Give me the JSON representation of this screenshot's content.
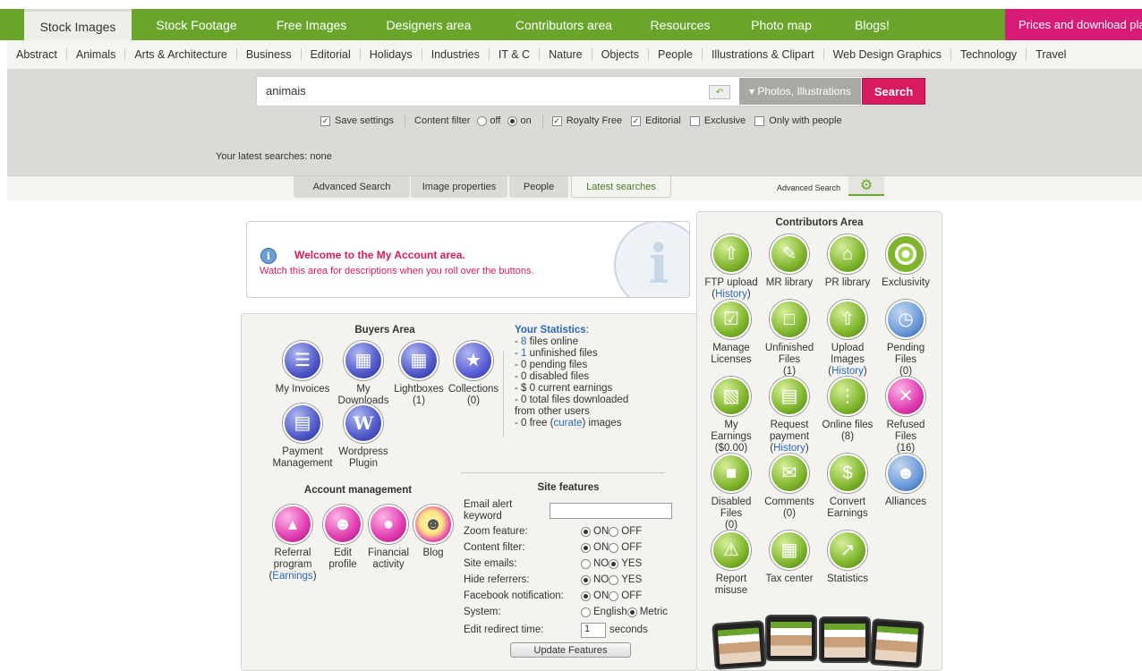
{
  "top_tabs": [
    "Stock Images",
    "Stock Footage",
    "Free Images",
    "Designers area",
    "Contributors area",
    "Resources",
    "Photo map",
    "Blogs!"
  ],
  "prices_label": "Prices and download plan",
  "categories": [
    "Abstract",
    "Animals",
    "Arts & Architecture",
    "Business",
    "Editorial",
    "Holidays",
    "Industries",
    "IT & C",
    "Nature",
    "Objects",
    "People",
    "Illustrations & Clipart",
    "Web Design Graphics",
    "Technology",
    "Travel"
  ],
  "search": {
    "value": "animais",
    "type_label": "Photos, Illustrations",
    "button": "Search"
  },
  "options": {
    "save_settings": "Save settings",
    "content_filter": "Content filter",
    "off": "off",
    "on": "on",
    "royalty_free": "Royalty Free",
    "editorial": "Editorial",
    "exclusive": "Exclusive",
    "only_people": "Only with people"
  },
  "latest_searches": "Your latest searches:  none",
  "subtabs": [
    "Advanced Search",
    "Image properties",
    "People",
    "Latest searches"
  ],
  "advanced_link": "Advanced Search",
  "welcome": {
    "title": "Welcome to the My Account area.",
    "desc": "Watch this area for descriptions when you roll over the buttons."
  },
  "buyers": {
    "title": "Buyers Area",
    "items": [
      {
        "l1": "My Invoices",
        "l2": ""
      },
      {
        "l1": "My",
        "l2": "Downloads"
      },
      {
        "l1": "Lightboxes",
        "l2": "(1)"
      },
      {
        "l1": "Collections",
        "l2": "(0)"
      },
      {
        "l1": "Payment",
        "l2": "Management"
      },
      {
        "l1": "Wordpress",
        "l2": "Plugin"
      }
    ]
  },
  "stats": {
    "title": "Your Statistics",
    "colon": ":",
    "dash": "- ",
    "n8": "8",
    "files_online": " files online",
    "n1": "1",
    "unfinished": " unfinished files",
    "pending": "- 0 pending files",
    "disabled": "- 0 disabled files",
    "earnings": "- $ 0 current earnings",
    "downloaded": "- 0 total files downloaded",
    "downloaded2": "from other users",
    "free_pre": "- 0 free (",
    "curate": "curate",
    "free_post": ") images"
  },
  "account": {
    "title": "Account management",
    "items": [
      {
        "l1": "Referral",
        "l2": "program",
        "l3a": "(",
        "l3b": "Earnings",
        "l3c": ")"
      },
      {
        "l1": "Edit",
        "l2": "profile"
      },
      {
        "l1": "Financial",
        "l2": "activity"
      },
      {
        "l1": "Blog",
        "l2": ""
      }
    ]
  },
  "features": {
    "title": "Site features",
    "email_label1": "Email alert",
    "email_label2": "keyword",
    "rows": [
      {
        "label": "Zoom feature:",
        "a": "ON",
        "b": "OFF",
        "sel": "a"
      },
      {
        "label": "Content filter:",
        "a": "ON",
        "b": "OFF",
        "sel": "a"
      },
      {
        "label": "Site emails:",
        "a": "NO",
        "b": "YES",
        "sel": "b"
      },
      {
        "label": "Hide referrers:",
        "a": "NO",
        "b": "YES",
        "sel": "a"
      },
      {
        "label": "Facebook notification:",
        "a": "ON",
        "b": "OFF",
        "sel": "a"
      },
      {
        "label": "System:",
        "a": "English",
        "b": "Metric",
        "sel": "b"
      }
    ],
    "redirect_label": "Edit redirect time:",
    "redirect_value": "1",
    "seconds": "seconds",
    "update": "Update Features"
  },
  "contrib": {
    "title": "Contributors Area",
    "items": [
      {
        "l1": "FTP upload",
        "l2": "",
        "link": "History"
      },
      {
        "l1": "MR library",
        "l2": ""
      },
      {
        "l1": "PR library",
        "l2": ""
      },
      {
        "l1": "Exclusivity",
        "l2": ""
      },
      {
        "l1": "Manage",
        "l2": "Licenses"
      },
      {
        "l1": "Unfinished",
        "l2": "Files",
        "l3": "(1)"
      },
      {
        "l1": "Upload",
        "l2": "Images",
        "link": "History"
      },
      {
        "l1": "Pending",
        "l2": "Files",
        "l3": "(0)"
      },
      {
        "l1": "My",
        "l2": "Earnings",
        "l3": "($0.00)"
      },
      {
        "l1": "Request",
        "l2": "payment",
        "link": "History"
      },
      {
        "l1": "Online files",
        "l2": "(8)"
      },
      {
        "l1": "Refused",
        "l2": "Files",
        "l3": "(16)"
      },
      {
        "l1": "Disabled",
        "l2": "Files",
        "l3": "(0)"
      },
      {
        "l1": "Comments",
        "l2": "(0)"
      },
      {
        "l1": "Convert",
        "l2": "Earnings"
      },
      {
        "l1": "Alliances",
        "l2": ""
      },
      {
        "l1": "Report",
        "l2": "misuse"
      },
      {
        "l1": "Tax center",
        "l2": ""
      },
      {
        "l1": "Statistics",
        "l2": ""
      }
    ]
  },
  "colors": {
    "green": "#6aa52b",
    "pink": "#d81b5e",
    "link": "#2a6ab4"
  }
}
